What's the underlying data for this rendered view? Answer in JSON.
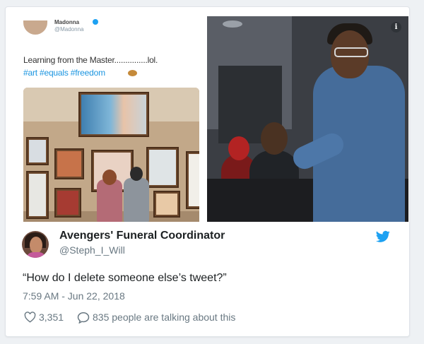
{
  "embedded_tweet": {
    "name": "Madonna",
    "handle": "@Madonna",
    "text": "Learning from the Master...............lol.",
    "hashtags": "#art #equals #freedom"
  },
  "tweet": {
    "display_name": "Avengers' Funeral Coordinator",
    "handle": "@Steph_I_Will",
    "text": "“How do I delete someone else’s tweet?”",
    "timestamp": "7:59 AM - Jun 22, 2018",
    "likes": "3,351",
    "talking": "835 people are talking about this"
  },
  "colors": {
    "accent": "#1da1f2",
    "text": "#1c2022",
    "muted": "#697882"
  },
  "icons": {
    "info": "i",
    "bird": "twitter-bird-icon",
    "heart": "heart-icon",
    "reply": "reply-icon"
  }
}
